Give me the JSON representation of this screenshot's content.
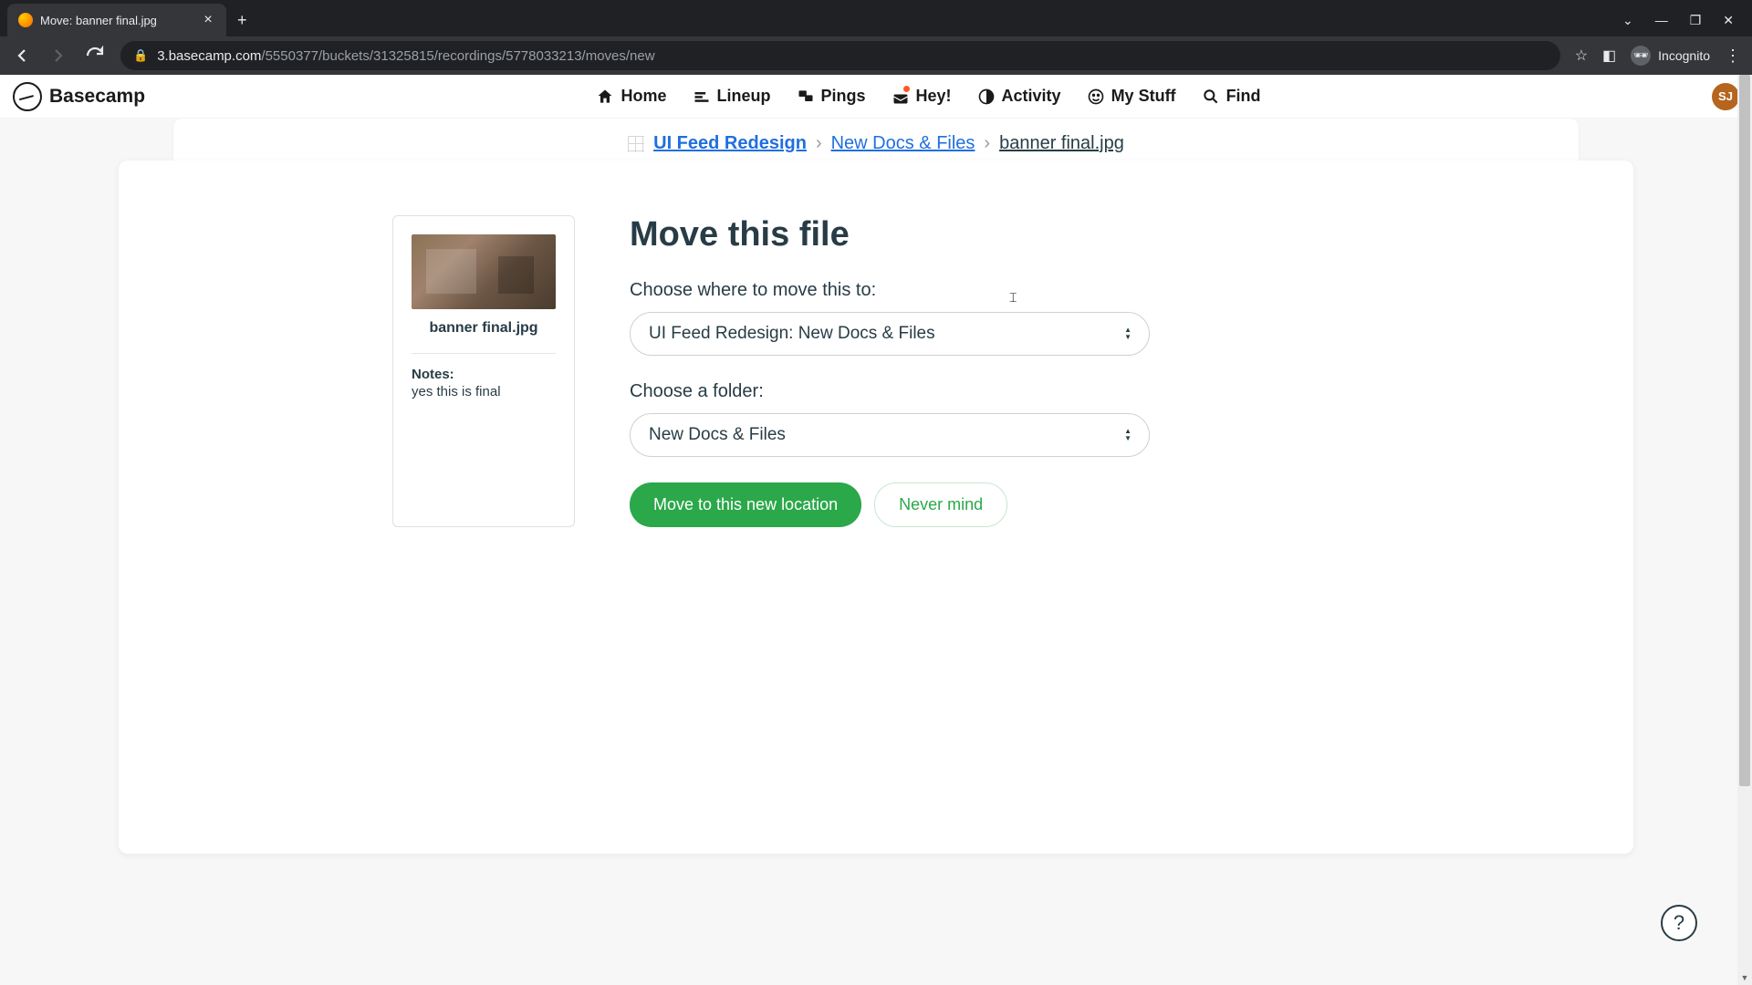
{
  "browser": {
    "tab_title": "Move: banner final.jpg",
    "url_domain": "3.basecamp.com",
    "url_path": "/5550377/buckets/31325815/recordings/5778033213/moves/new",
    "incognito_label": "Incognito"
  },
  "app": {
    "logo_text": "Basecamp",
    "nav": {
      "home": "Home",
      "lineup": "Lineup",
      "pings": "Pings",
      "hey": "Hey!",
      "activity": "Activity",
      "mystuff": "My Stuff",
      "find": "Find"
    },
    "avatar_initials": "SJ"
  },
  "breadcrumb": {
    "project": "UI Feed Redesign",
    "section": "New Docs & Files",
    "file": "banner final.jpg"
  },
  "file": {
    "name": "banner final.jpg",
    "notes_label": "Notes:",
    "notes_text": "yes this is final"
  },
  "form": {
    "title": "Move this file",
    "dest_label": "Choose where to move this to:",
    "dest_value": "UI Feed Redesign: New Docs & Files",
    "folder_label": "Choose a folder:",
    "folder_value": "New Docs & Files",
    "submit": "Move to this new location",
    "cancel": "Never mind"
  },
  "help": "?"
}
